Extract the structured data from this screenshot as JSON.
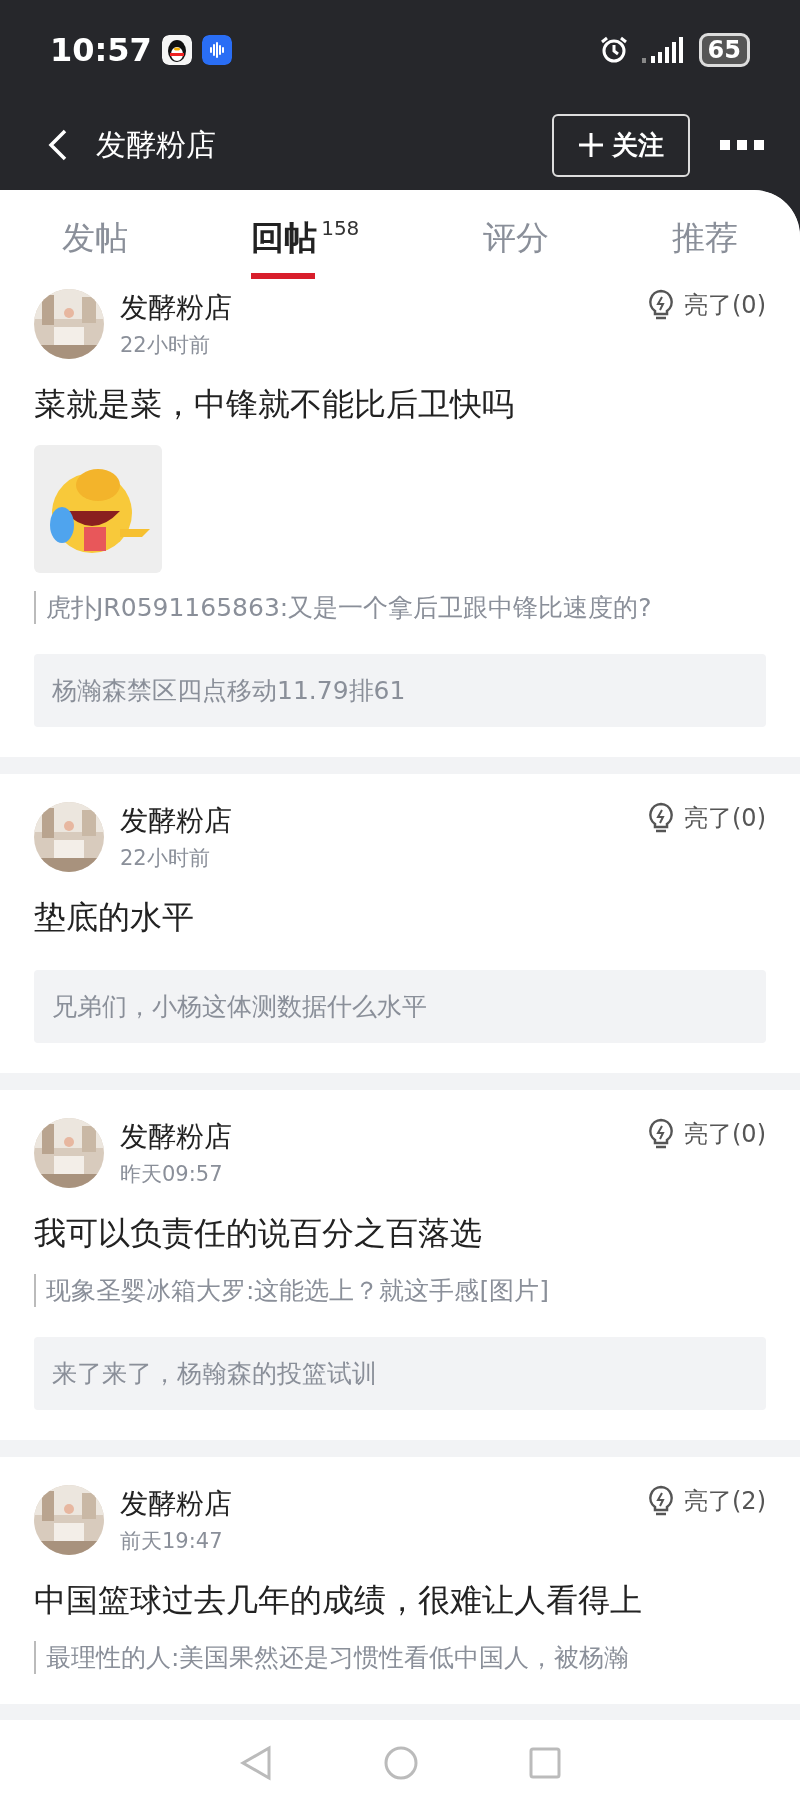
{
  "status_bar": {
    "time": "10:57",
    "battery": "65"
  },
  "header": {
    "title": "发酵粉店",
    "follow_label": "关注"
  },
  "tabs": [
    {
      "label": "发帖",
      "selected": false
    },
    {
      "label": "回帖",
      "count": "158",
      "selected": true
    },
    {
      "label": "评分",
      "selected": false
    },
    {
      "label": "推荐",
      "selected": false
    }
  ],
  "posts": [
    {
      "author": "发酵粉店",
      "time": "22小时前",
      "likes": "亮了(0)",
      "text": "菜就是菜，中锋就不能比后卫快吗",
      "quote": "虎扑JR0591165863:又是一个拿后卫跟中锋比速度的?",
      "topic": "杨瀚森禁区四点移动11.79排61"
    },
    {
      "author": "发酵粉店",
      "time": "22小时前",
      "likes": "亮了(0)",
      "text": "垫底的水平",
      "topic": "兄弟们，小杨这体测数据什么水平"
    },
    {
      "author": "发酵粉店",
      "time": "昨天09:57",
      "likes": "亮了(0)",
      "text": "我可以负责任的说百分之百落选",
      "quote": "现象圣婴冰箱大罗:这能选上？就这手感[图片]",
      "topic": "来了来了，杨翰森的投篮试训"
    },
    {
      "author": "发酵粉店",
      "time": "前天19:47",
      "likes": "亮了(2)",
      "text": "中国篮球过去几年的成绩，很难让人看得上",
      "quote": "最理性的人:美国果然还是习惯性看低中国人，被杨瀚"
    }
  ]
}
